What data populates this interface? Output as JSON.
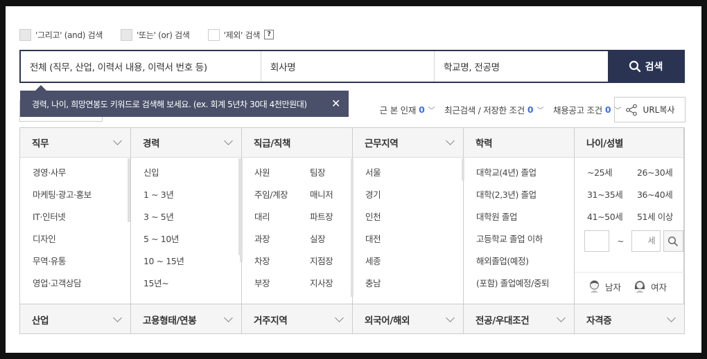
{
  "search_options": [
    {
      "label": "'그리고' (and) 검색",
      "checked": false
    },
    {
      "label": "'또는' (or) 검색",
      "checked": false
    },
    {
      "label": "'제외' 검색",
      "checked": false
    }
  ],
  "help_label": "?",
  "search": {
    "field_all": "전체 (직무, 산업, 이력서 내용, 이력서 번호 등)",
    "field_company": "회사명",
    "field_school": "학교명, 전공명",
    "button_label": "검색"
  },
  "tooltip": {
    "text": "경력, 나이, 희망연봉도 키워드로 검색해 보세요. (ex. 회계 5년차 30대 4천만원대)",
    "close": "✕"
  },
  "links": {
    "viewed": {
      "label": "본 인재",
      "count": "0",
      "prefix": "근"
    },
    "recent": {
      "label": "최근검색 / 저장한 조건",
      "count": "0"
    },
    "jobpost": {
      "label": "채용공고 조건",
      "count": "0"
    },
    "url_copy": "URL복사"
  },
  "filters": {
    "job": {
      "title": "직무",
      "items": [
        "경영·사무",
        "마케팅·광고·홍보",
        "IT·인터넷",
        "디자인",
        "무역·유통",
        "영업·고객상담"
      ]
    },
    "career": {
      "title": "경력",
      "items": [
        "신입",
        "1 ~ 3년",
        "3 ~ 5년",
        "5 ~ 10년",
        "10 ~ 15년",
        "15년~"
      ]
    },
    "position": {
      "title": "직급/직책",
      "items": [
        "사원",
        "팀장",
        "주임/계장",
        "매니저",
        "대리",
        "파트장",
        "과장",
        "실장",
        "차장",
        "지점장",
        "부장",
        "지사장"
      ]
    },
    "region": {
      "title": "근무지역",
      "items": [
        "서울",
        "경기",
        "인천",
        "대전",
        "세종",
        "충남"
      ]
    },
    "education": {
      "title": "학력",
      "items": [
        "대학교(4년) 졸업",
        "대학(2,3년) 졸업",
        "대학원 졸업",
        "고등학교 졸업 이하",
        "해외졸업(예정)",
        "(포함) 졸업예정/중퇴"
      ]
    },
    "age": {
      "title": "나이/성별",
      "items": [
        "~25세",
        "26~30세",
        "31~35세",
        "36~40세",
        "41~50세",
        "51세 이상"
      ],
      "tilde": "~",
      "input_max_placeholder": "세",
      "male": "남자",
      "female": "여자"
    }
  },
  "bottom_filters": [
    "산업",
    "고용형태/연봉",
    "거주지역",
    "외국어/해외",
    "전공/우대조건",
    "자격증"
  ],
  "colors": {
    "navy": "#2b3353",
    "tooltip_bg": "#4a5069",
    "count_blue": "#3d6ee8"
  }
}
